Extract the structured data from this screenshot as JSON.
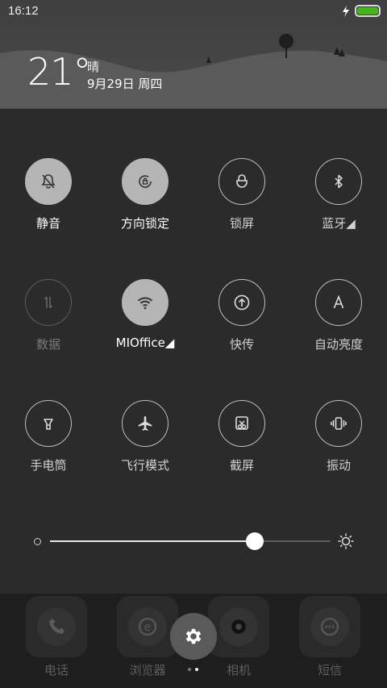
{
  "status_bar": {
    "time": "16:12",
    "battery_level": 1.0,
    "battery_color": "#47b520",
    "charging_icon": "lightning-bolt-icon"
  },
  "weather": {
    "temperature": "21°",
    "condition": "晴",
    "date": "9月29日 周四"
  },
  "toggles": [
    {
      "label": "静音",
      "icon": "bell-mute-icon",
      "state": "active"
    },
    {
      "label": "方向锁定",
      "icon": "rotation-lock-icon",
      "state": "active"
    },
    {
      "label": "锁屏",
      "icon": "lock-icon",
      "state": "normal"
    },
    {
      "label": "蓝牙◢",
      "icon": "bluetooth-icon",
      "state": "normal"
    },
    {
      "label": "数据",
      "icon": "mobile-data-icon",
      "state": "disabled"
    },
    {
      "label": "MIOffice◢",
      "icon": "wifi-icon",
      "state": "active"
    },
    {
      "label": "快传",
      "icon": "quick-transfer-icon",
      "state": "normal"
    },
    {
      "label": "自动亮度",
      "icon": "auto-brightness-icon",
      "state": "normal"
    },
    {
      "label": "手电筒",
      "icon": "flashlight-icon",
      "state": "normal"
    },
    {
      "label": "飞行模式",
      "icon": "airplane-icon",
      "state": "normal"
    },
    {
      "label": "截屏",
      "icon": "screenshot-icon",
      "state": "normal"
    },
    {
      "label": "振动",
      "icon": "vibrate-icon",
      "state": "normal"
    }
  ],
  "brightness": {
    "level": 0.73,
    "low_icon": "brightness-low-icon",
    "high_icon": "brightness-high-icon"
  },
  "dock": {
    "apps": [
      {
        "label": "电话",
        "icon": "phone-icon"
      },
      {
        "label": "浏览器",
        "icon": "browser-icon"
      },
      {
        "label": "相机",
        "icon": "camera-icon"
      },
      {
        "label": "短信",
        "icon": "messages-icon"
      }
    ],
    "settings_icon": "gear-icon",
    "page_indicator": {
      "count": 2,
      "current": 2
    }
  }
}
